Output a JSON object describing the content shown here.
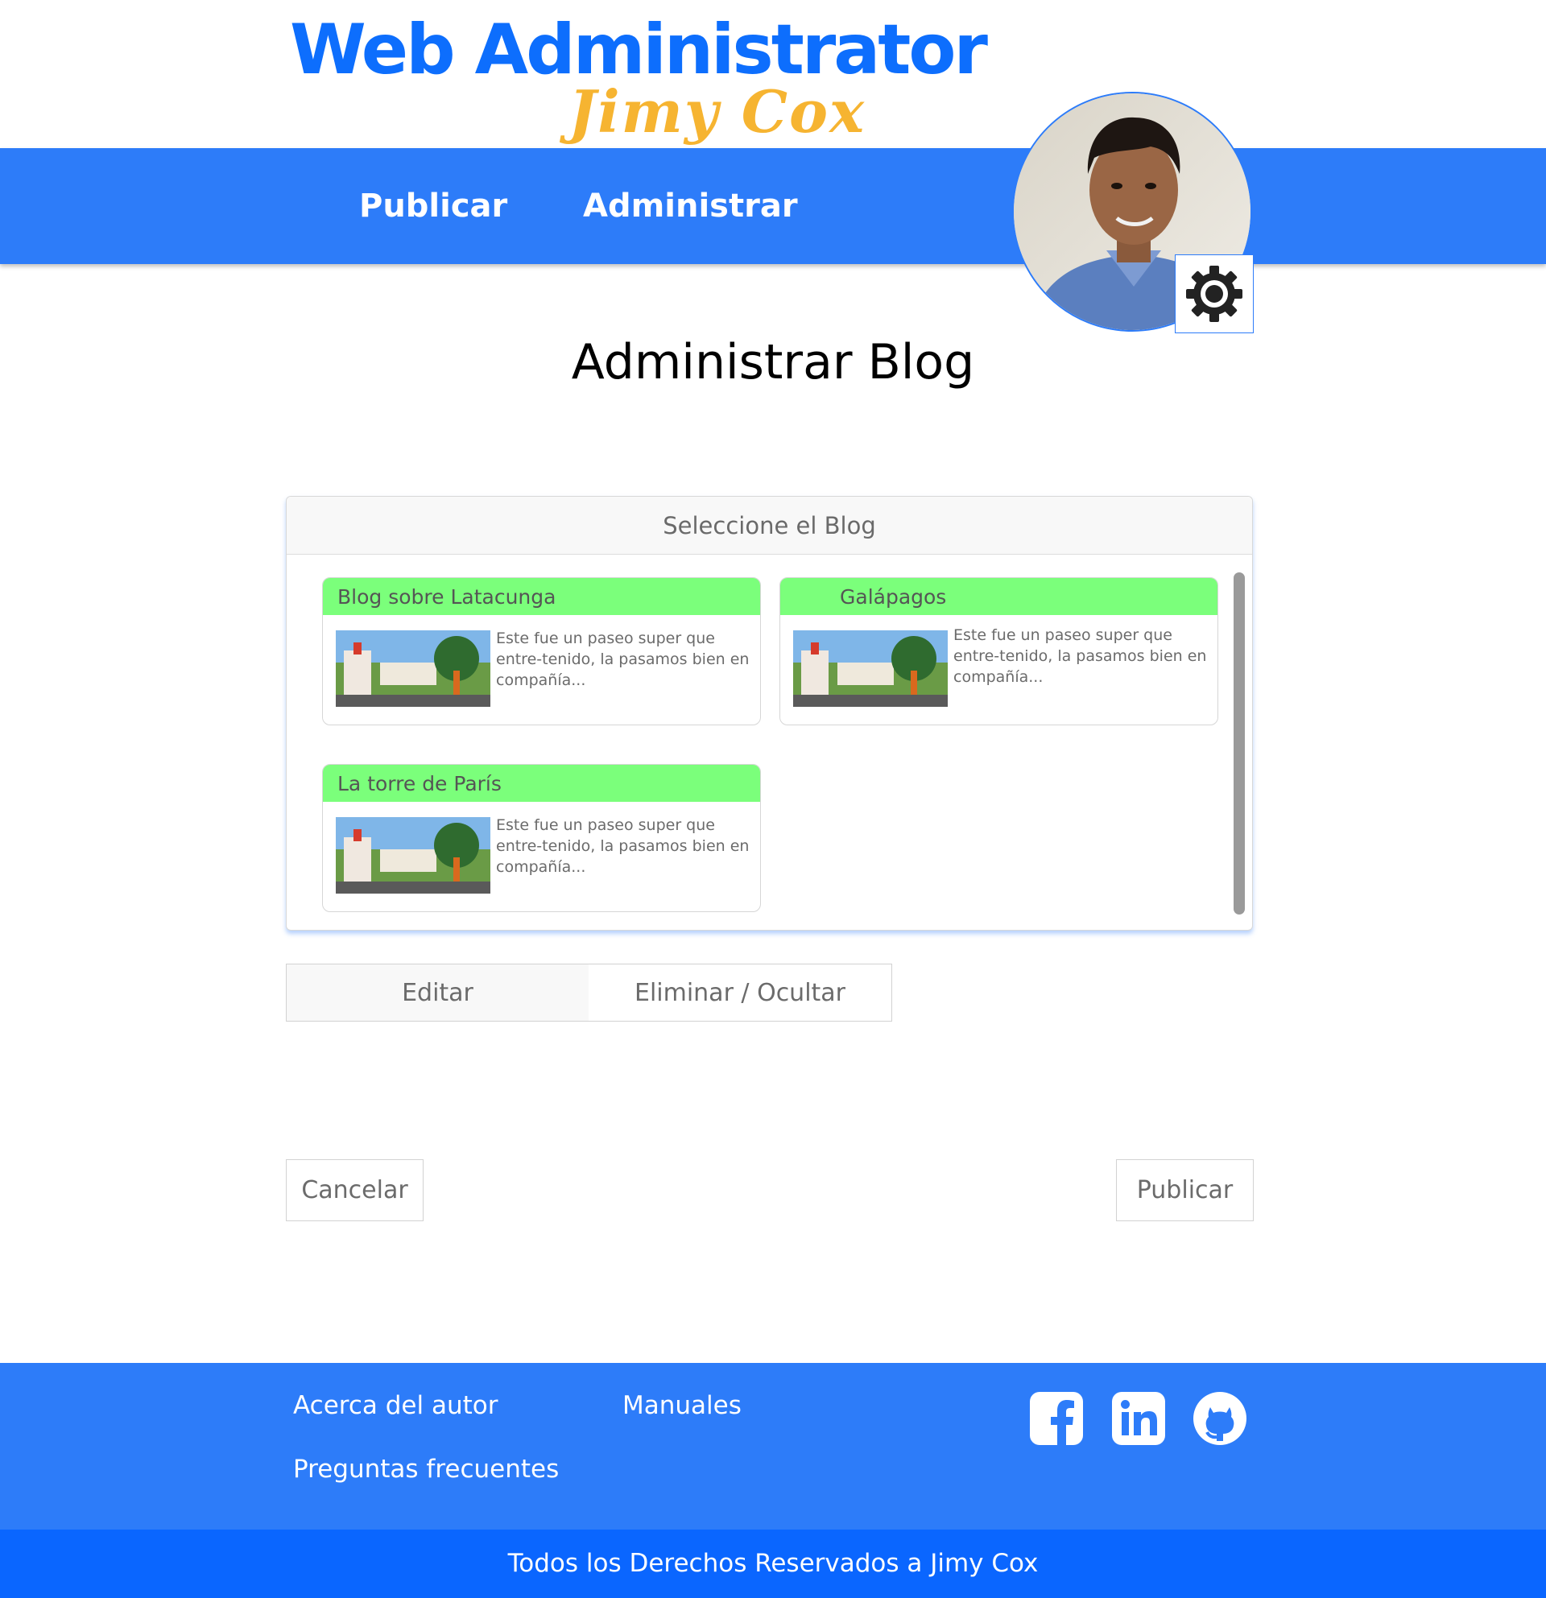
{
  "logo": {
    "main": "Web Administrator",
    "sub": "Jimy Cox"
  },
  "nav": {
    "items": [
      {
        "label": "Publicar"
      },
      {
        "label": "Administrar"
      }
    ]
  },
  "avatar": {
    "icon": "user-photo",
    "settings_icon": "gear-icon"
  },
  "page": {
    "title": "Administrar Blog"
  },
  "panel": {
    "header": "Seleccione el Blog",
    "cards": [
      {
        "title": "Blog sobre Latacunga",
        "excerpt": "Este fue un paseo super que entre-tenido, la pasamos bien en compañía..."
      },
      {
        "title": "Galápagos",
        "excerpt": "Este fue un paseo super que entre-tenido, la pasamos bien en compañía..."
      },
      {
        "title": "La torre de París",
        "excerpt": "Este fue un paseo super que entre-tenido, la pasamos bien en compañía..."
      }
    ]
  },
  "tabs": {
    "edit": "Editar",
    "delete": "Eliminar / Ocultar"
  },
  "actions": {
    "cancel": "Cancelar",
    "publish": "Publicar"
  },
  "footer": {
    "links": {
      "about": "Acerca del autor",
      "manuals": "Manuales",
      "faq": "Preguntas frecuentes"
    },
    "social": [
      "facebook-icon",
      "linkedin-icon",
      "github-icon"
    ],
    "copyright": "Todos los Derechos Reservados a Jimy Cox"
  },
  "colors": {
    "primary": "#2d7cf9",
    "footer_bottom": "#0a66ff",
    "card_header": "#7bff7b",
    "logo_blue": "#0d6efd",
    "logo_orange": "#f6b431"
  }
}
